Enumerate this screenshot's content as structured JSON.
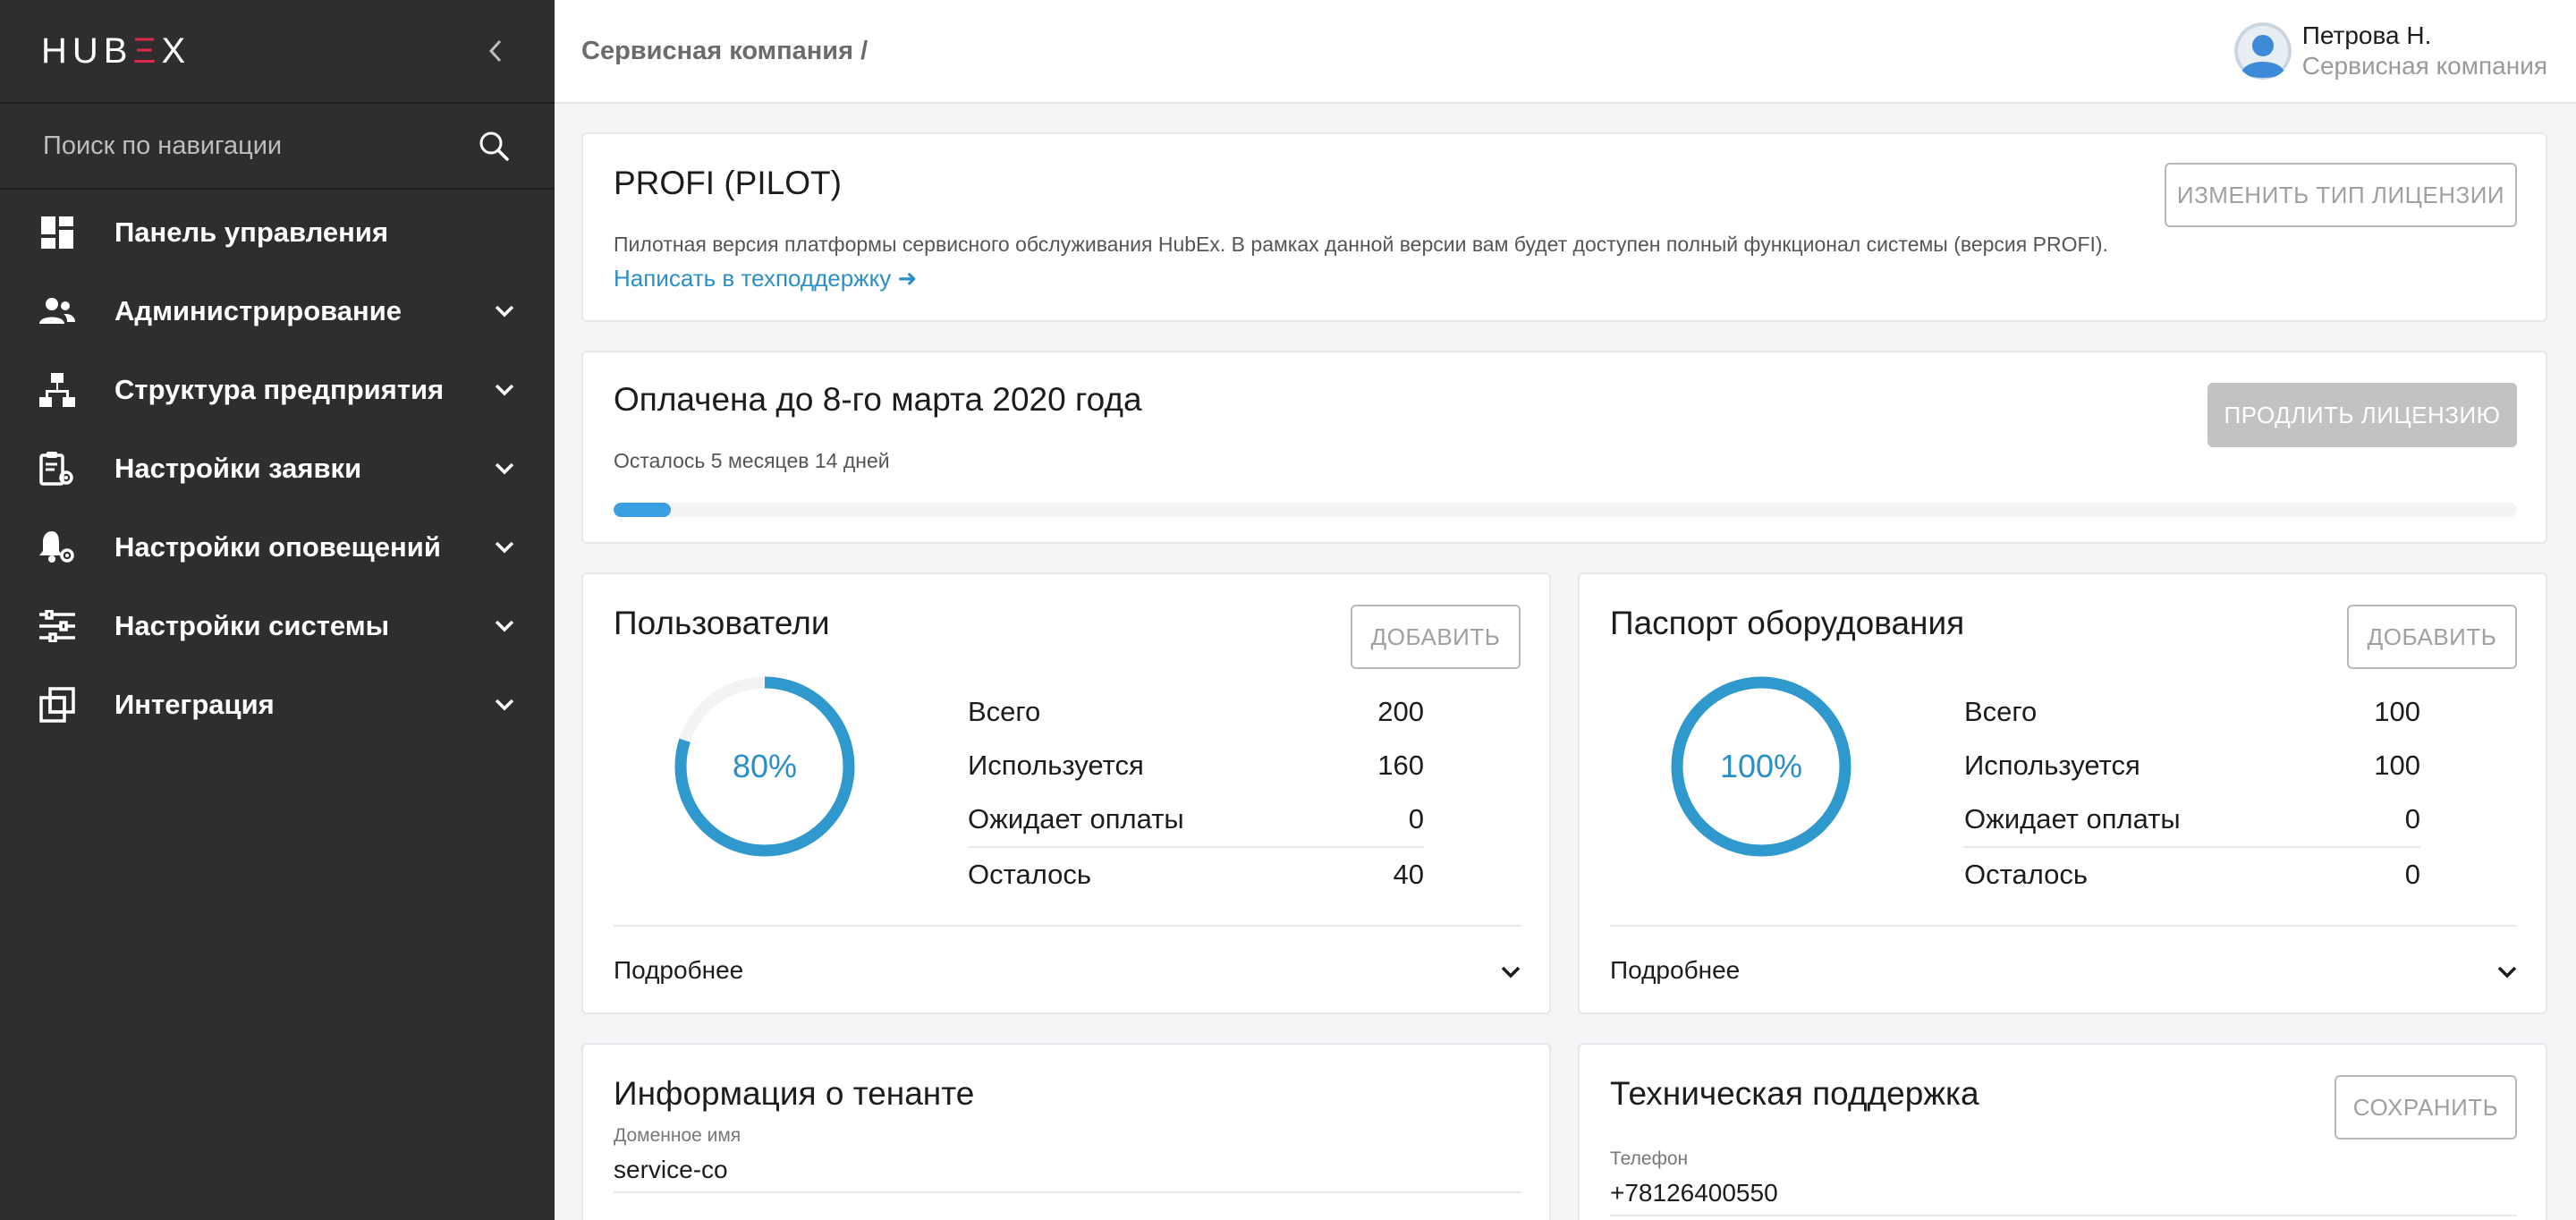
{
  "sidebar": {
    "logo": {
      "hu": "HU",
      "b": "B",
      "ex": "Ξ",
      "x": "X"
    },
    "search_placeholder": "Поиск по навигации",
    "items": [
      {
        "label": "Панель управления",
        "icon": "dashboard-icon"
      },
      {
        "label": "Администрирование",
        "icon": "users-icon"
      },
      {
        "label": "Структура предприятия",
        "icon": "hierarchy-icon"
      },
      {
        "label": "Настройки заявки",
        "icon": "clipboard-gear-icon"
      },
      {
        "label": "Настройки оповещений",
        "icon": "bell-gear-icon"
      },
      {
        "label": "Настройки системы",
        "icon": "sliders-icon"
      },
      {
        "label": "Интеграция",
        "icon": "integration-icon"
      }
    ]
  },
  "header": {
    "breadcrumb": "Сервисная компания /",
    "user_name": "Петрова Н.",
    "user_company": "Сервисная компания"
  },
  "license": {
    "title": "PROFI (PILOT)",
    "description": "Пилотная версия платформы сервисного обслуживания HubEx. В рамках данной версии вам будет доступен полный функционал системы (версия PROFI).",
    "support_link": "Написать в техподдержку ➜",
    "change_button": "ИЗМЕНИТЬ ТИП ЛИЦЕНЗИИ"
  },
  "payment": {
    "title": "Оплачена до 8-го марта 2020 года",
    "remaining": "Осталось 5 месяцев 14 дней",
    "progress": 0.03,
    "extend_button": "ПРОДЛИТЬ ЛИЦЕНЗИЮ"
  },
  "users": {
    "title": "Пользователи",
    "add_button": "ДОБАВИТЬ",
    "percent_label": "80%",
    "percent": 0.8,
    "rows": [
      {
        "label": "Всего",
        "value": "200"
      },
      {
        "label": "Используется",
        "value": "160"
      },
      {
        "label": "Ожидает оплаты",
        "value": "0"
      },
      {
        "label": "Осталось",
        "value": "40"
      }
    ],
    "details": "Подробнее"
  },
  "equipment": {
    "title": "Паспорт оборудования",
    "add_button": "ДОБАВИТЬ",
    "percent_label": "100%",
    "percent": 1.0,
    "rows": [
      {
        "label": "Всего",
        "value": "100"
      },
      {
        "label": "Используется",
        "value": "100"
      },
      {
        "label": "Ожидает оплаты",
        "value": "0"
      },
      {
        "label": "Осталось",
        "value": "0"
      }
    ],
    "details": "Подробнее"
  },
  "tenant": {
    "title": "Информация о тенанте",
    "domain_caption": "Доменное имя",
    "domain_value": "service-co"
  },
  "support": {
    "title": "Техническая поддержка",
    "save_button": "СОХРАНИТЬ",
    "phone_caption": "Телефон",
    "phone_value": "+78126400550"
  },
  "colors": {
    "sidebar_bg": "#2e2e2f",
    "accent": "#2a8fc7",
    "donut": "#2f98cc",
    "logo_accent": "#e0284b"
  }
}
